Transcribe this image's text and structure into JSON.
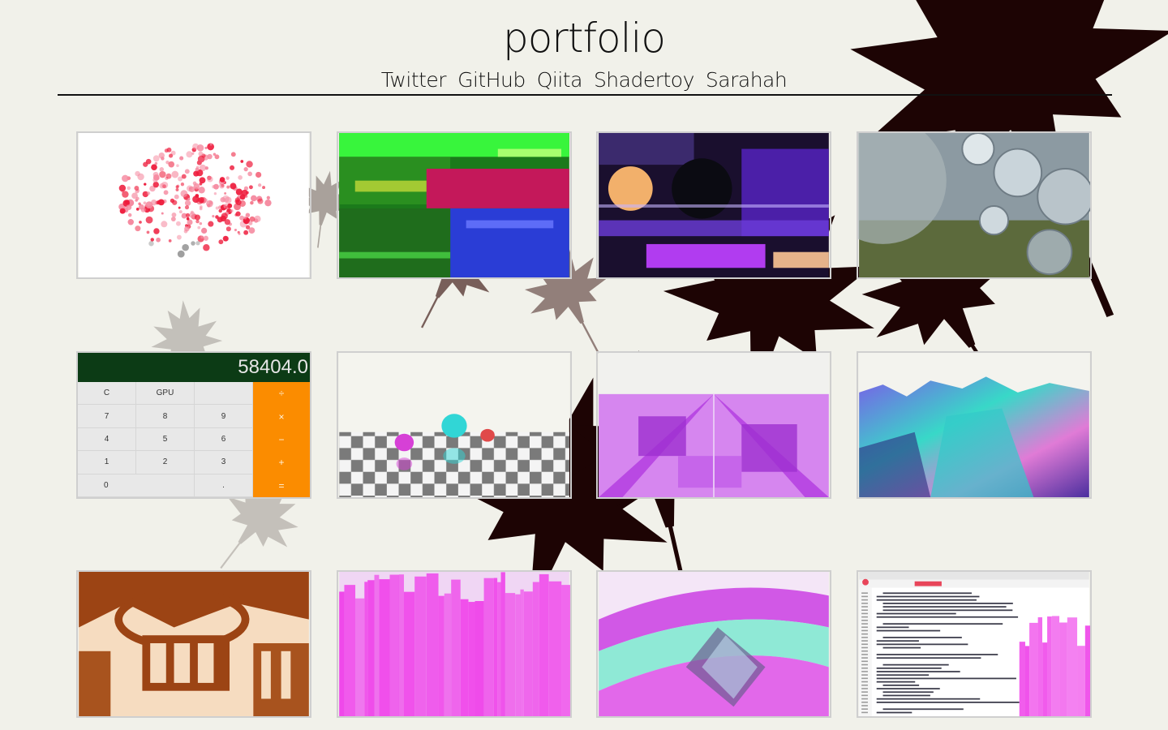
{
  "header": {
    "title": "portfolio",
    "links": [
      "Twitter",
      "GitHub",
      "Qiita",
      "Shadertoy",
      "Sarahah"
    ]
  },
  "calculator": {
    "display": "58404.0",
    "keys": [
      "C",
      "GPU",
      "",
      "÷",
      "7",
      "8",
      "9",
      "×",
      "4",
      "5",
      "6",
      "−",
      "1",
      "2",
      "3",
      "+",
      "0",
      ".",
      "="
    ]
  },
  "colors": {
    "background": "#f1f1ea",
    "leaf_dark": "#1d0404",
    "calc_display": "#0c3b15",
    "calc_operator": "#fb8c00"
  },
  "tiles": [
    {
      "icon": "red-particles-thumbnail"
    },
    {
      "icon": "green-glitch-thumbnail"
    },
    {
      "icon": "purple-glitch-thumbnail"
    },
    {
      "icon": "glass-bubbles-thumbnail"
    },
    {
      "icon": "gpu-calculator-thumbnail"
    },
    {
      "icon": "raymarch-spheres-thumbnail"
    },
    {
      "icon": "purple-blocks-thumbnail"
    },
    {
      "icon": "rainbow-terrain-thumbnail"
    },
    {
      "icon": "brown-fractal-city-thumbnail"
    },
    {
      "icon": "magenta-skyline-thumbnail"
    },
    {
      "icon": "neon-tunnel-thumbnail"
    },
    {
      "icon": "shader-editor-thumbnail"
    }
  ]
}
